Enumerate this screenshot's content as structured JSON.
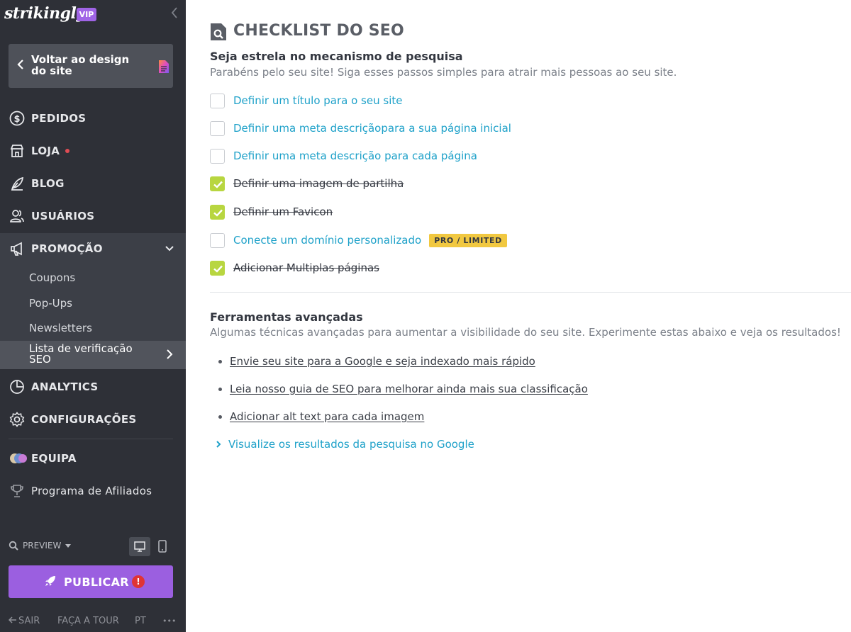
{
  "app": {
    "brand": "strikingly",
    "badge": "VIP"
  },
  "sidebar": {
    "back_label": "Voltar ao design do site",
    "nav": [
      {
        "label": "PEDIDOS",
        "icon": "dollar-circle-icon"
      },
      {
        "label": "LOJA",
        "icon": "store-icon"
      },
      {
        "label": "BLOG",
        "icon": "feather-icon"
      },
      {
        "label": "USUÁRIOS",
        "icon": "users-icon"
      },
      {
        "label": "PROMOÇÃO",
        "icon": "megaphone-icon"
      },
      {
        "label": "ANALYTICS",
        "icon": "pie-chart-icon"
      },
      {
        "label": "CONFIGURAÇÕES",
        "icon": "gear-icon"
      },
      {
        "label": "EQUIPA",
        "icon": "team-avatars-icon"
      },
      {
        "label": "Programa de Afiliados",
        "icon": "trophy-icon"
      }
    ],
    "promo_sub": [
      "Coupons",
      "Pop-Ups",
      "Newsletters",
      "Lista de verificação SEO"
    ],
    "preview_label": "PREVIEW",
    "publish_label": "PUBLICAR",
    "publish_alert": "!",
    "footer": {
      "exit": "SAIR",
      "tour": "FAÇA A TOUR",
      "lang": "PT",
      "more": "•••"
    },
    "colors": {
      "bg": "#2e3037",
      "publish": "#9b5fe0",
      "vip": "#a064e6",
      "notify_dot": "#e04c54"
    }
  },
  "main": {
    "title": "CHECKLIST DO SEO",
    "section1": {
      "heading": "Seja estrela no mecanismo de pesquisa",
      "description": "Parabéns pelo seu site! Siga esses passos simples para atrair mais pessoas ao seu site.",
      "items": [
        {
          "label": "Definir um título para o seu site",
          "checked": false
        },
        {
          "label": "Definir uma meta descriçãopara a sua página inicial",
          "checked": false
        },
        {
          "label": "Definir uma meta descrição para cada página",
          "checked": false
        },
        {
          "label": "Definir uma imagem de partilha",
          "checked": true
        },
        {
          "label": "Definir um Favicon",
          "checked": true
        },
        {
          "label": "Conecte um domínio personalizado",
          "checked": false,
          "badge": "PRO / LIMITED"
        },
        {
          "label": "Adicionar Multiplas páginas",
          "checked": true
        }
      ]
    },
    "section2": {
      "heading": "Ferramentas avançadas",
      "description": "Algumas técnicas avançadas para aumentar a visibilidade do seu site. Experimente estas abaixo e veja os resultados!",
      "links": [
        "Envie seu site para a Google e seja indexado mais rápido",
        "Leia nosso guia de SEO para melhorar ainda mais sua classificação",
        "Adicionar alt text para cada imagem"
      ],
      "expand_label": "Visualize os resultados da pesquisa no Google"
    },
    "colors": {
      "link": "#1ea1c9",
      "check": "#b8d640",
      "pro_badge": "#f1c840"
    }
  }
}
